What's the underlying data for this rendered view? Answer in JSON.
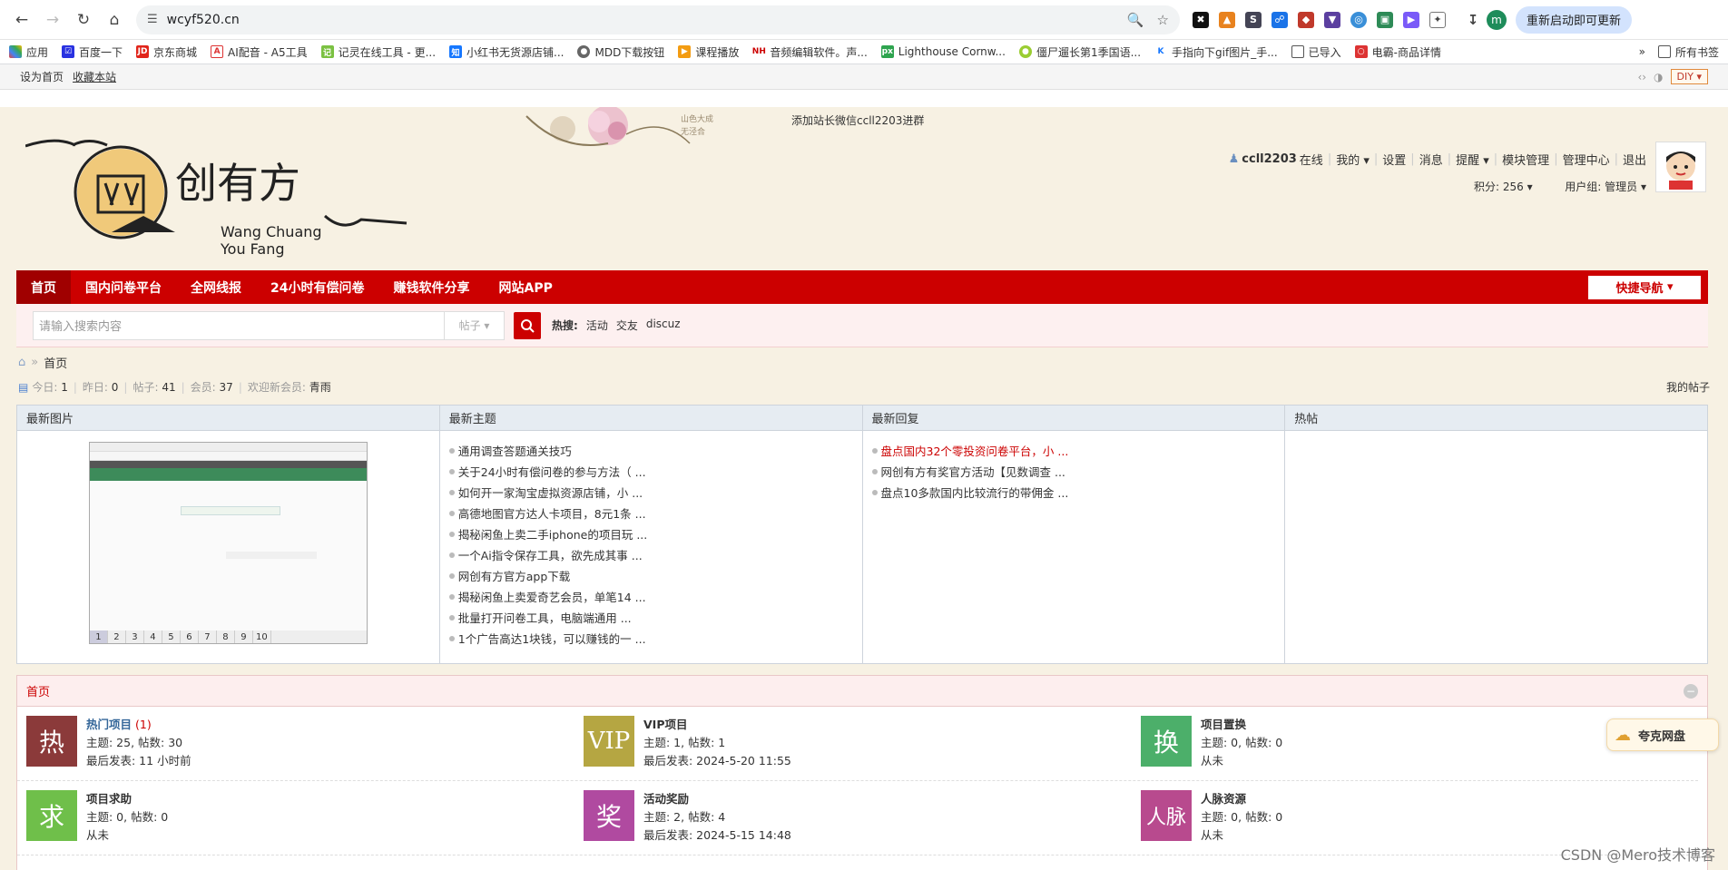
{
  "browser": {
    "url": "wcyf520.cn",
    "update_label": "重新启动即可更新",
    "profile_initial": "m",
    "bookmarks": [
      "应用",
      "百度一下",
      "京东商城",
      "AI配音 - A5工具",
      "记灵在线工具 - 更...",
      "小红书无货源店铺...",
      "MDD下载按钮",
      "课程播放",
      "音频编辑软件。声...",
      "Lighthouse Cornw...",
      "僵尸遛长第1季国语...",
      "手指向下gif图片_手...",
      "已导入",
      "电霸-商品详情"
    ],
    "bookmarks_overflow": "»",
    "all_bookmarks": "所有书签"
  },
  "topbar": {
    "set_home": "设为首页",
    "bookmark": "收藏本站",
    "diy": "DIY"
  },
  "header": {
    "notice": "添加站长微信ccll2203进群",
    "logo_en_1": "Wang Chuang",
    "logo_en_2": "You Fang",
    "username": "ccll2203",
    "online": "在线",
    "links": [
      "我的",
      "设置",
      "消息",
      "提醒",
      "模块管理",
      "管理中心",
      "退出"
    ],
    "points": "积分: 256",
    "usergroup": "用户组: 管理员"
  },
  "nav": {
    "items": [
      "首页",
      "国内问卷平台",
      "全网线报",
      "24小时有偿问卷",
      "赚钱软件分享",
      "网站APP"
    ],
    "quick_nav": "快捷导航"
  },
  "search": {
    "placeholder": "请输入搜索内容",
    "type": "帖子",
    "hot_label": "热搜:",
    "hot": [
      "活动",
      "交友",
      "discuz"
    ]
  },
  "breadcrumb": {
    "current": "首页"
  },
  "stats": {
    "today_label": "今日:",
    "today": "1",
    "yesterday_label": "昨日:",
    "yesterday": "0",
    "posts_label": "帖子:",
    "posts": "41",
    "members_label": "会员:",
    "members": "37",
    "welcome_label": "欢迎新会员:",
    "newest": "青雨",
    "my_posts": "我的帖子"
  },
  "portal": {
    "columns": [
      "最新图片",
      "最新主题",
      "最新回复",
      "热帖"
    ],
    "thumb_pages": [
      "1",
      "2",
      "3",
      "4",
      "5",
      "6",
      "7",
      "8",
      "9",
      "10"
    ],
    "latest_topics": [
      "通用调查答题通关技巧",
      "关于24小时有偿问卷的参与方法（ ...",
      "如何开一家淘宝虚拟资源店铺，小 ...",
      "高德地图官方达人卡项目，8元1条 ...",
      "揭秘闲鱼上卖二手iphone的项目玩 ...",
      "一个Ai指令保存工具，欲先成其事 ...",
      "网创有方官方app下载",
      "揭秘闲鱼上卖爱奇艺会员，单笔14 ...",
      "批量打开问卷工具，电脑端通用 ...",
      "1个广告高达1块钱，可以赚钱的一 ..."
    ],
    "latest_replies": [
      "盘点国内32个零投资问卷平台，小 ...",
      "网创有方有奖官方活动【见数调查 ...",
      "盘点10多款国内比较流行的带佣金 ..."
    ]
  },
  "forum": {
    "title": "首页",
    "boards": [
      {
        "icon": "热",
        "color": "#8b3a3a",
        "name": "热门项目",
        "count": "(1)",
        "topics": "主题: 25, 帖数: 30",
        "last": "最后发表: 11 小时前"
      },
      {
        "icon": "VIP",
        "color": "#b5a642",
        "name": "VIP项目",
        "count": "",
        "topics": "主题: 1, 帖数: 1",
        "last": "最后发表: 2024-5-20 11:55"
      },
      {
        "icon": "换",
        "color": "#4caf6a",
        "name": "项目置换",
        "count": "",
        "topics": "主题: 0, 帖数: 0",
        "last": "从未"
      },
      {
        "icon": "求",
        "color": "#6fbf4a",
        "name": "项目求助",
        "count": "",
        "topics": "主题: 0, 帖数: 0",
        "last": "从未"
      },
      {
        "icon": "奖",
        "color": "#b04aa0",
        "name": "活动奖励",
        "count": "",
        "topics": "主题: 2, 帖数: 4",
        "last": "最后发表: 2024-5-15 14:48"
      },
      {
        "icon": "人脉",
        "color": "#b84a8e",
        "name": "人脉资源",
        "count": "",
        "topics": "主题: 0, 帖数: 0",
        "last": "从未"
      }
    ]
  },
  "floating": {
    "pan_label": "夸克网盘"
  },
  "watermark": "CSDN @Mero技术博客"
}
